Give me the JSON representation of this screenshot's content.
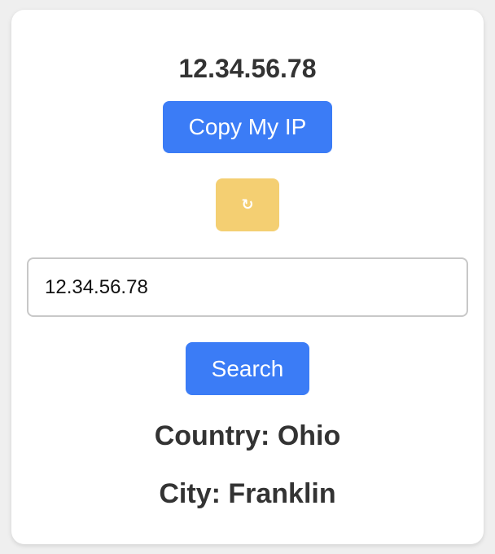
{
  "ip_display": "12.34.56.78",
  "copy_button": {
    "label": "Copy My IP",
    "color": "#3b7cf6"
  },
  "refresh_button": {
    "label": "↻",
    "icon": "refresh-icon",
    "color": "#f4cf72"
  },
  "search": {
    "value": "12.34.56.78",
    "button_label": "Search",
    "button_color": "#3b7cf6"
  },
  "result": {
    "country_text": "Country: Ohio",
    "city_text": "City: Franklin"
  }
}
